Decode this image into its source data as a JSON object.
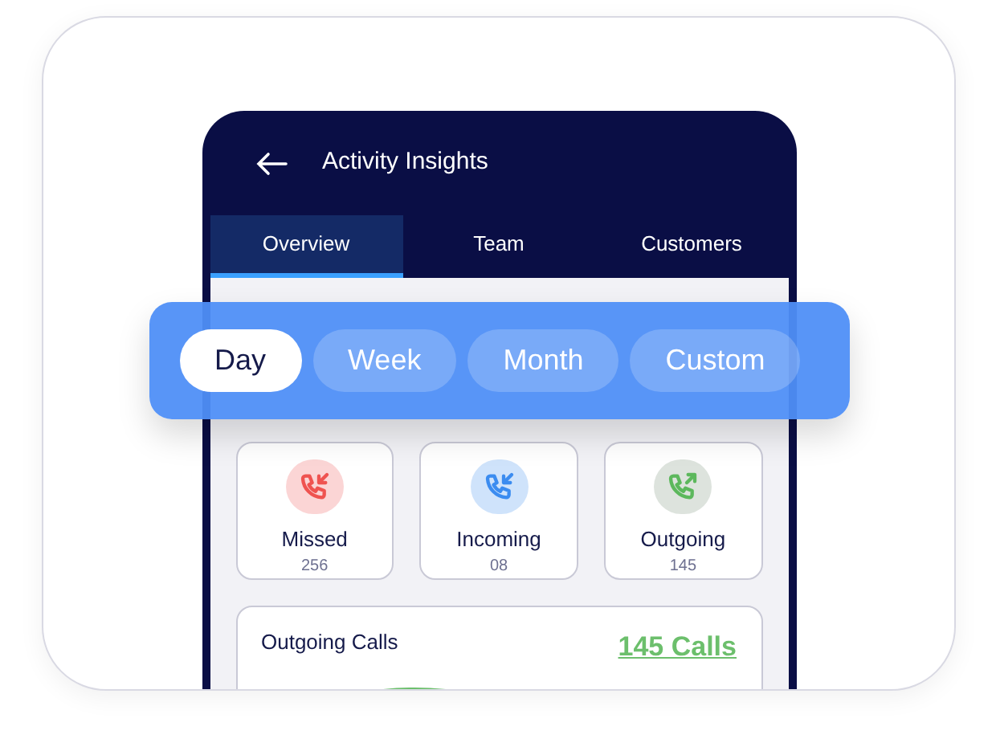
{
  "header": {
    "title": "Activity Insights"
  },
  "tabs": [
    {
      "label": "Overview",
      "selected": true
    },
    {
      "label": "Team",
      "selected": false
    },
    {
      "label": "Customers",
      "selected": false
    }
  ],
  "periods": [
    {
      "label": "Day",
      "selected": true
    },
    {
      "label": "Week",
      "selected": false
    },
    {
      "label": "Month",
      "selected": false
    },
    {
      "label": "Custom",
      "selected": false
    }
  ],
  "stats": [
    {
      "kind": "missed",
      "label": "Missed",
      "count": "256",
      "color": "#ef5350"
    },
    {
      "kind": "incoming",
      "label": "Incoming",
      "count": "08",
      "color": "#3b8cf0"
    },
    {
      "kind": "outgoing",
      "label": "Outgoing",
      "count": "145",
      "color": "#5cb85c"
    }
  ],
  "summary": {
    "title": "Outgoing Calls",
    "total": "145 Calls"
  }
}
